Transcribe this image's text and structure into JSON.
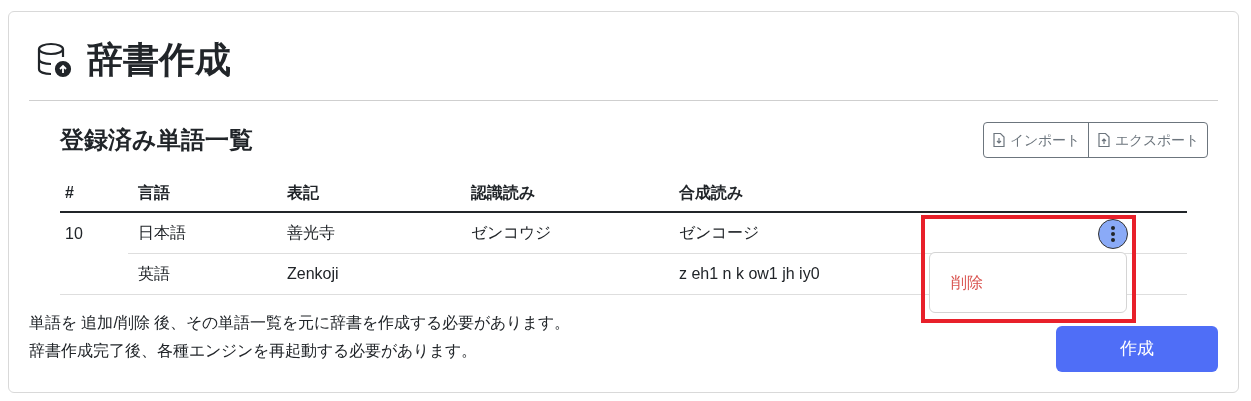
{
  "title": "辞書作成",
  "section": {
    "heading": "登録済み単語一覧",
    "actions": [
      {
        "kind": "import",
        "label": "インポート"
      },
      {
        "kind": "export",
        "label": "エクスポート"
      }
    ]
  },
  "table": {
    "columns": [
      "#",
      "言語",
      "表記",
      "認識読み",
      "合成読み"
    ],
    "rows": [
      {
        "number": "10",
        "menu_open": true,
        "highlighted": true,
        "menu_items": [
          "削除"
        ],
        "entries": [
          {
            "language": "日本語",
            "notation": "善光寺",
            "recognition": "ゼンコウジ",
            "synthesis": "ゼンコージ"
          },
          {
            "language": "英語",
            "notation": "Zenkoji",
            "synthesis": "z eh1 n k ow1 jh iy0"
          }
        ]
      }
    ]
  },
  "notes": [
    "単語を 追加/削除 後、その単語一覧を元に辞書を作成する必要があります。",
    "辞書作成完了後、各種エンジンを再起動する必要があります。"
  ],
  "create_button": "作成"
}
